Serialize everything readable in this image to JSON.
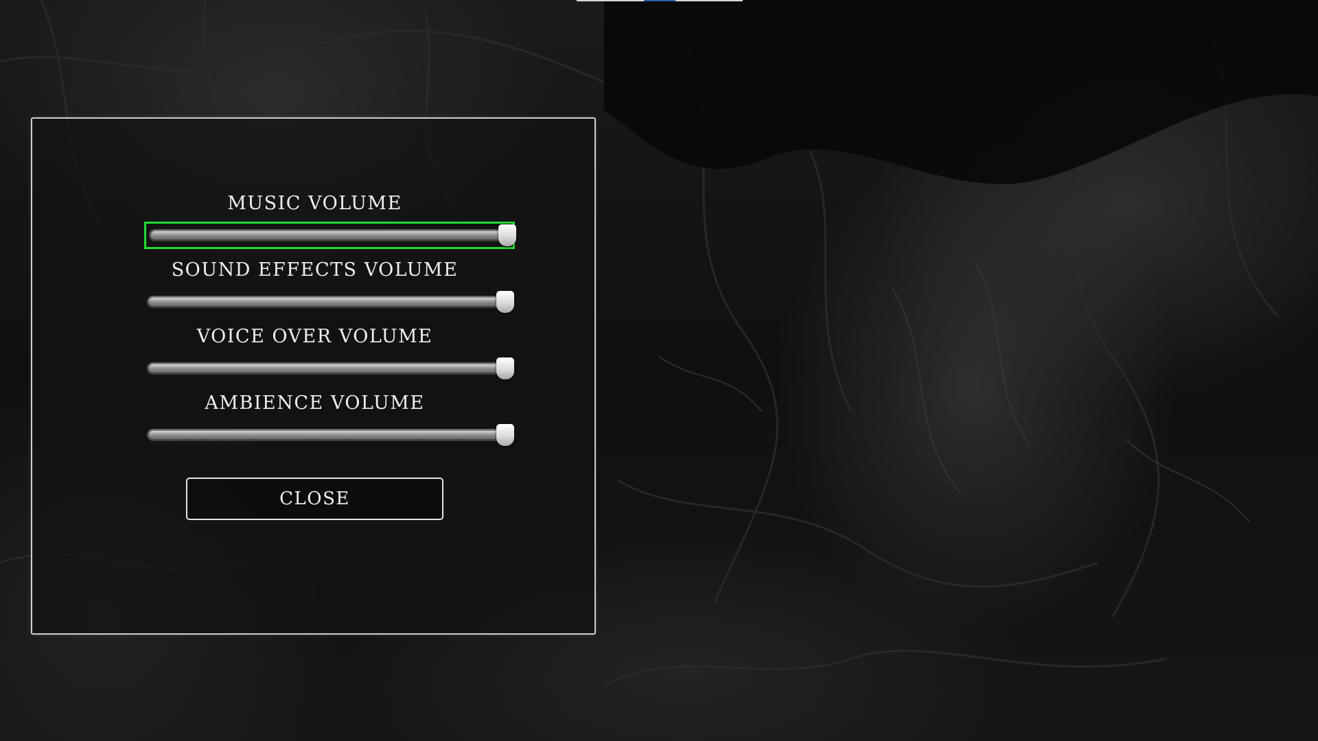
{
  "background": {
    "scene": "dark-cave-illustration"
  },
  "colors": {
    "focus_outline": "#22dd33",
    "panel_border": "#cfcfcf",
    "text": "#f0f0f0"
  },
  "settings_panel": {
    "sliders": [
      {
        "label": "MUSIC VOLUME",
        "value": 1.0,
        "focused": true
      },
      {
        "label": "SOUND EFFECTS VOLUME",
        "value": 1.0,
        "focused": false
      },
      {
        "label": "VOICE OVER VOLUME",
        "value": 1.0,
        "focused": false
      },
      {
        "label": "AMBIENCE VOLUME",
        "value": 1.0,
        "focused": false
      }
    ],
    "close_label": "CLOSE"
  }
}
